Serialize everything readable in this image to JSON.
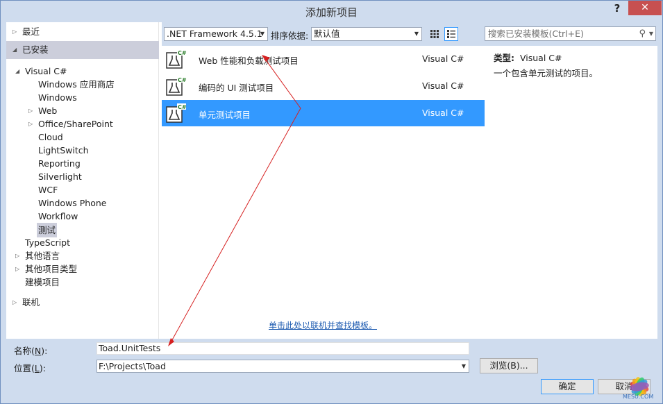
{
  "window": {
    "title": "添加新项目",
    "help_label": "?",
    "close_label": "✕"
  },
  "tree": {
    "recent": "最近",
    "installed": "已安装",
    "visual_csharp": "Visual C#",
    "children": [
      "Windows 应用商店",
      "Windows",
      "Web",
      "Office/SharePoint",
      "Cloud",
      "LightSwitch",
      "Reporting",
      "Silverlight",
      "WCF",
      "Windows Phone",
      "Workflow",
      "测试"
    ],
    "typescript": "TypeScript",
    "other_languages": "其他语言",
    "other_project_types": "其他项目类型",
    "modeling_projects": "建模项目",
    "online": "联机"
  },
  "toolbar": {
    "framework": ".NET Framework 4.5.1",
    "sort_label": "排序依据:",
    "sort_value": "默认值",
    "search_placeholder": "搜索已安装模板(Ctrl+E)"
  },
  "templates": [
    {
      "name": "Web 性能和负载测试项目",
      "lang": "Visual C#"
    },
    {
      "name": "编码的 UI 测试项目",
      "lang": "Visual C#"
    },
    {
      "name": "单元测试项目",
      "lang": "Visual C#"
    }
  ],
  "online_link": "单击此处以联机并查找模板。",
  "details": {
    "type_label": "类型:",
    "type_value": "Visual C#",
    "description": "一个包含单元测试的项目。"
  },
  "form": {
    "name_label_pre": "名称(",
    "name_label_key": "N",
    "name_label_post": "):",
    "name_value": "Toad.UnitTests",
    "location_label_pre": "位置(",
    "location_label_key": "L",
    "location_label_post": "):",
    "location_value": "F:\\Projects\\Toad",
    "browse_label": "浏览(B)...",
    "ok_label": "确定",
    "cancel_label": "取消"
  },
  "colors": {
    "selection": "#3399ff",
    "link": "#1c5ab0",
    "annotation": "#d62020"
  },
  "watermark": "MESU.COM"
}
